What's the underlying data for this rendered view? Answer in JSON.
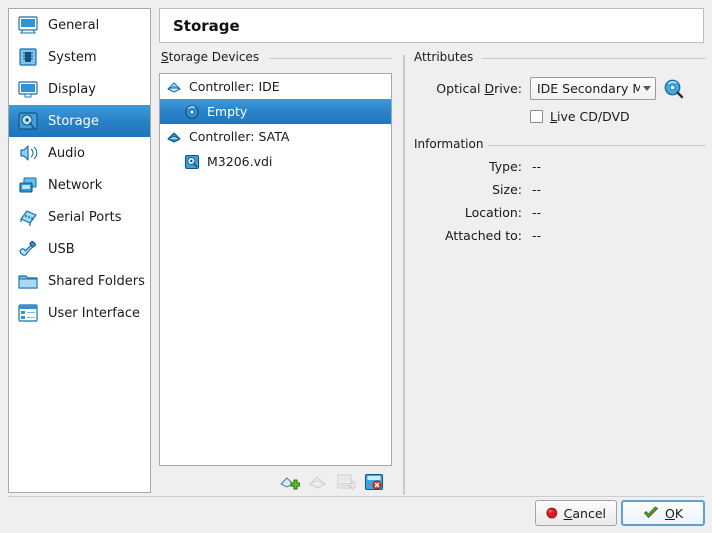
{
  "header": {
    "title": "Storage"
  },
  "sidebar": {
    "items": [
      {
        "label": "General",
        "icon": "monitor-icon",
        "selected": false
      },
      {
        "label": "System",
        "icon": "chip-icon",
        "selected": false
      },
      {
        "label": "Display",
        "icon": "screen-icon",
        "selected": false
      },
      {
        "label": "Storage",
        "icon": "harddisk-icon",
        "selected": true
      },
      {
        "label": "Audio",
        "icon": "speaker-icon",
        "selected": false
      },
      {
        "label": "Network",
        "icon": "network-icon",
        "selected": false
      },
      {
        "label": "Serial Ports",
        "icon": "serialport-icon",
        "selected": false
      },
      {
        "label": "USB",
        "icon": "usb-icon",
        "selected": false
      },
      {
        "label": "Shared Folders",
        "icon": "folder-icon",
        "selected": false
      },
      {
        "label": "User Interface",
        "icon": "window-icon",
        "selected": false
      }
    ]
  },
  "storage_devices": {
    "group_label": "Storage Devices",
    "group_label_accel": "S",
    "tree": [
      {
        "label": "Controller: IDE",
        "icon": "ide-controller-icon",
        "level": 0,
        "selected": false
      },
      {
        "label": "Empty",
        "icon": "optical-disc-icon",
        "level": 1,
        "selected": true
      },
      {
        "label": "Controller: SATA",
        "icon": "sata-controller-icon",
        "level": 0,
        "selected": false
      },
      {
        "label": "M3206.vdi",
        "icon": "harddisk-drive-icon",
        "level": 1,
        "selected": false
      }
    ],
    "toolbar": [
      {
        "name": "add-controller-button",
        "icon": "add-controller-icon",
        "enabled": true
      },
      {
        "name": "remove-controller-button",
        "icon": "remove-controller-icon",
        "enabled": false
      },
      {
        "name": "add-attachment-button",
        "icon": "add-attachment-icon",
        "enabled": false
      },
      {
        "name": "remove-attachment-button",
        "icon": "remove-attachment-icon",
        "enabled": true
      }
    ]
  },
  "attributes": {
    "group_label": "Attributes",
    "optical_drive": {
      "label": "Optical Drive:",
      "label_accel": "D",
      "value": "IDE Secondary Mas",
      "picker_icon": "cd-browse-icon"
    },
    "live_cd": {
      "label": "Live CD/DVD",
      "label_accel": "L",
      "checked": false
    }
  },
  "information": {
    "group_label": "Information",
    "rows": [
      {
        "label": "Type:",
        "value": "--"
      },
      {
        "label": "Size:",
        "value": "--"
      },
      {
        "label": "Location:",
        "value": "--"
      },
      {
        "label": "Attached to:",
        "value": "--"
      }
    ]
  },
  "footer": {
    "cancel": {
      "label": "Cancel",
      "accel": "C",
      "icon": "cancel-icon"
    },
    "ok": {
      "label": "OK",
      "accel": "O",
      "icon": "ok-icon",
      "default": true
    }
  },
  "colors": {
    "selection_blue": "#2a82c8",
    "window_bg": "#efefef",
    "panel_bg": "#ffffff",
    "border": "#a8a8a8"
  }
}
